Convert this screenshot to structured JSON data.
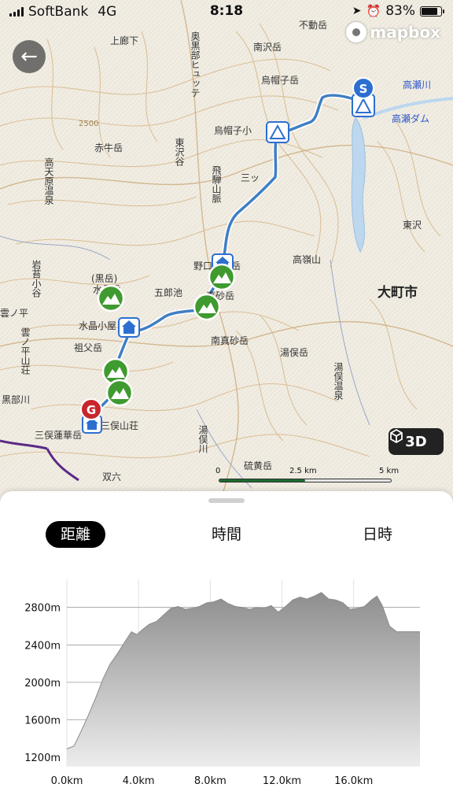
{
  "status_bar": {
    "carrier": "SoftBank",
    "network": "4G",
    "time": "8:18",
    "battery": "83%",
    "battery_level": 0.83
  },
  "map": {
    "attribution": "mapbox",
    "view_3d_label": "3D",
    "scale": {
      "labels": [
        "0",
        "2.5 km",
        "5 km"
      ]
    },
    "start_marker": "S",
    "goal_marker": "G",
    "place_labels": [
      "上廊下",
      "奥黒部ヒュッテ",
      "不動岳",
      "南沢岳",
      "烏帽子岳",
      "高瀬ダム",
      "高瀬川",
      "烏帽子小",
      "赤牛岳",
      "東沢谷",
      "三ッ",
      "飛騨山脈",
      "高天原温泉",
      "野口五郎岳",
      "高嶺山",
      "大町市",
      "岩苔小谷",
      "(黒岳)",
      "水晶岳",
      "五郎池",
      "真砂岳",
      "水晶小屋",
      "雲ノ平",
      "雲ノ平山荘",
      "祖父岳",
      "南真砂岳",
      "湯俣岳",
      "湯俣温泉",
      "黒部川",
      "三俣山荘",
      "三俣蓮華岳",
      "硫黄岳",
      "双六",
      "湯俣川",
      "2500",
      "東沢"
    ]
  },
  "back_button": {
    "icon": "arrow-left-icon"
  },
  "tabs": [
    {
      "label": "距離",
      "active": true
    },
    {
      "label": "時間",
      "active": false
    },
    {
      "label": "日時",
      "active": false
    }
  ],
  "chart_data": {
    "type": "area",
    "title": "",
    "xlabel": "",
    "ylabel": "",
    "x_tick_labels": [
      "0.0km",
      "4.0km",
      "8.0km",
      "12.0km",
      "16.0km"
    ],
    "y_tick_labels": [
      "1200m",
      "1600m",
      "2000m",
      "2400m",
      "2800m"
    ],
    "xlim": [
      0,
      19.7
    ],
    "ylim": [
      1200,
      2800
    ],
    "grid": true,
    "x_km": [
      0,
      0.4,
      0.8,
      1.2,
      1.6,
      2.0,
      2.4,
      2.8,
      3.2,
      3.6,
      3.9,
      4.2,
      4.6,
      5.0,
      5.4,
      5.8,
      6.2,
      6.6,
      7.0,
      7.4,
      7.8,
      8.2,
      8.6,
      9.0,
      9.4,
      9.8,
      10.2,
      10.6,
      11.0,
      11.4,
      11.8,
      12.2,
      12.6,
      13.0,
      13.4,
      13.8,
      14.2,
      14.6,
      15.0,
      15.4,
      15.8,
      16.2,
      16.6,
      17.0,
      17.3,
      17.6,
      18.0,
      18.4,
      18.8,
      19.2,
      19.7
    ],
    "elevation_m": [
      1290,
      1320,
      1480,
      1650,
      1830,
      2030,
      2190,
      2300,
      2420,
      2540,
      2510,
      2560,
      2620,
      2650,
      2720,
      2790,
      2810,
      2780,
      2790,
      2810,
      2850,
      2860,
      2890,
      2840,
      2810,
      2800,
      2780,
      2800,
      2790,
      2820,
      2750,
      2810,
      2880,
      2910,
      2890,
      2920,
      2960,
      2890,
      2880,
      2850,
      2780,
      2790,
      2810,
      2880,
      2920,
      2820,
      2600,
      2540,
      2540,
      2540,
      2540
    ]
  }
}
